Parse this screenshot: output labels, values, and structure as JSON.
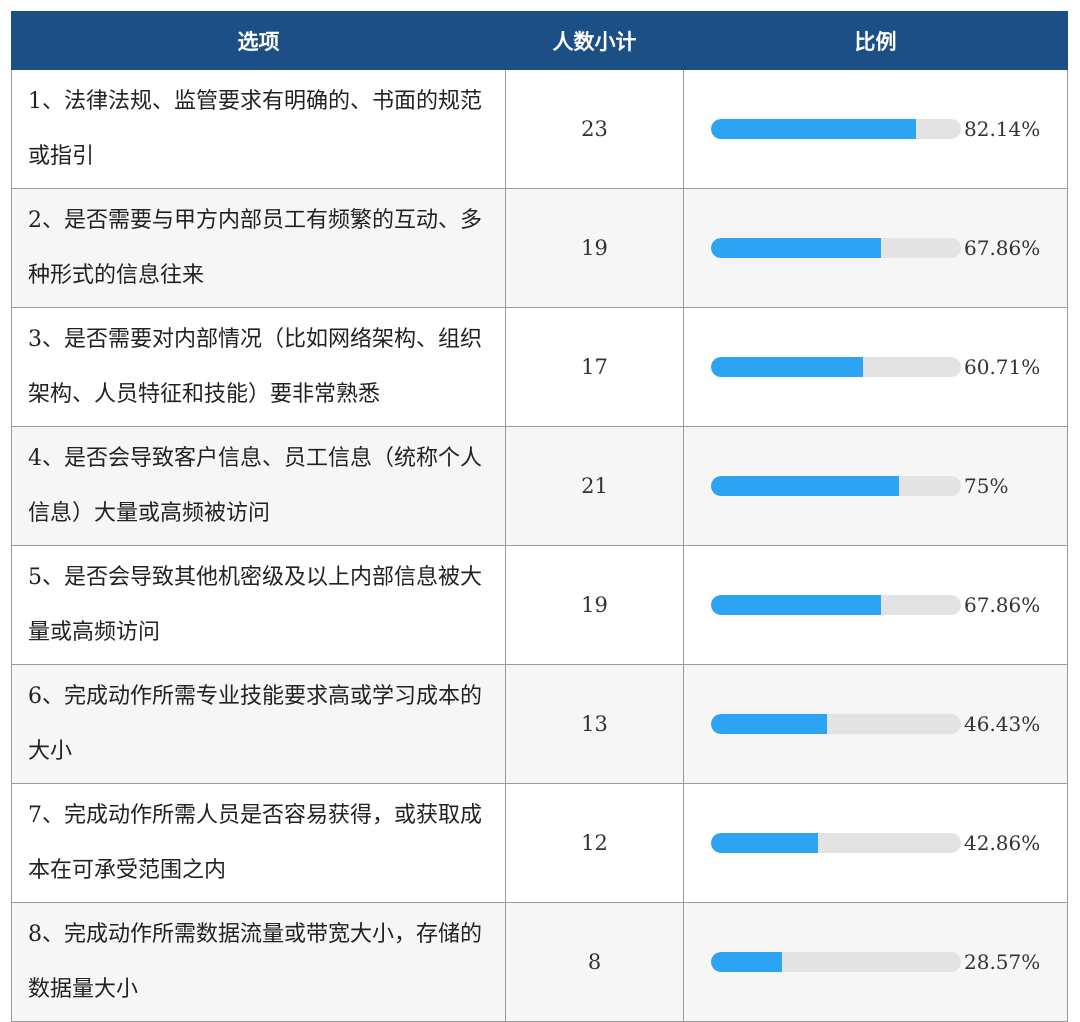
{
  "header": {
    "option_label": "选项",
    "count_label": "人数小计",
    "ratio_label": "比例"
  },
  "colors": {
    "header_bg": "#1c4f86",
    "bar_fill": "#2ca4f3",
    "bar_track": "#e3e3e3"
  },
  "rows": [
    {
      "option": "1、法律法规、监管要求有明确的、书面的规范或指引",
      "count": "23",
      "ratio_text": "82.14%",
      "ratio_value": 82.14
    },
    {
      "option": "2、是否需要与甲方内部员工有频繁的互动、多种形式的信息往来",
      "count": "19",
      "ratio_text": "67.86%",
      "ratio_value": 67.86
    },
    {
      "option": "3、是否需要对内部情况（比如网络架构、组织架构、人员特征和技能）要非常熟悉",
      "count": "17",
      "ratio_text": "60.71%",
      "ratio_value": 60.71
    },
    {
      "option": "4、是否会导致客户信息、员工信息（统称个人信息）大量或高频被访问",
      "count": "21",
      "ratio_text": "75%",
      "ratio_value": 75
    },
    {
      "option": "5、是否会导致其他机密级及以上内部信息被大量或高频访问",
      "count": "19",
      "ratio_text": "67.86%",
      "ratio_value": 67.86
    },
    {
      "option": "6、完成动作所需专业技能要求高或学习成本的大小",
      "count": "13",
      "ratio_text": "46.43%",
      "ratio_value": 46.43
    },
    {
      "option": "7、完成动作所需人员是否容易获得，或获取成本在可承受范围之内",
      "count": "12",
      "ratio_text": "42.86%",
      "ratio_value": 42.86
    },
    {
      "option": "8、完成动作所需数据流量或带宽大小，存储的数据量大小",
      "count": "8",
      "ratio_text": "28.57%",
      "ratio_value": 28.57
    }
  ]
}
